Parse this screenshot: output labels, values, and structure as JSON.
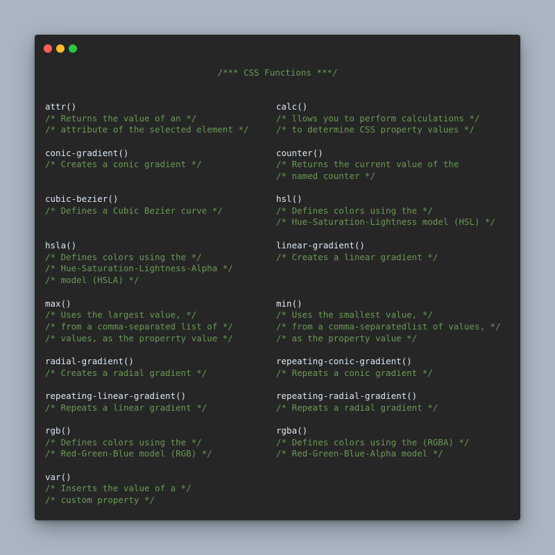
{
  "window": {
    "controls": [
      "close",
      "minimize",
      "maximize"
    ],
    "title_comment": "/*** CSS Functions ***/"
  },
  "left_column": [
    {
      "name": "attr",
      "parens": "()",
      "comments": [
        "/* Returns the value of an */",
        "/* attribute of the selected element */"
      ]
    },
    {
      "name": "conic-gradient",
      "parens": "()",
      "comments": [
        "/* Creates a conic gradient */"
      ]
    },
    {
      "name": "cubic-bezier",
      "parens": "()",
      "comments": [
        "/* Defines a Cubic Bezier curve */"
      ]
    },
    {
      "name": "hsla",
      "parens": "()",
      "comments": [
        "/* Defines colors using the */",
        "/* Hue-Saturation-Lightness-Alpha */",
        "/* model (HSLA) */"
      ]
    },
    {
      "name": "max",
      "parens": "()",
      "comments": [
        "/* Uses the largest value, */",
        "/* from a comma-separated list of */",
        "/* values, as the properrty value */"
      ]
    },
    {
      "name": "radial-gradient",
      "parens": "()",
      "comments": [
        "/* Creates a radial gradient */"
      ]
    },
    {
      "name": "repeating-linear-gradient",
      "parens": "()",
      "comments": [
        "/* Repeats a linear gradient */"
      ]
    },
    {
      "name": "rgb",
      "parens": "()",
      "comments": [
        "/* Defines colors using the */",
        "/* Red-Green-Blue model (RGB) */"
      ]
    },
    {
      "name": "var",
      "parens": "()",
      "comments": [
        "/* Inserts the value of a */",
        "/* custom property */"
      ]
    }
  ],
  "right_column": [
    {
      "name": "calc",
      "parens": "()",
      "comments": [
        "/* llows you to perform calculations */",
        "/* to determine CSS property values */"
      ]
    },
    {
      "name": "counter",
      "parens": "()",
      "comments": [
        "/* Returns the current value of the",
        "/* named counter */"
      ]
    },
    {
      "name": "hsl",
      "parens": "()",
      "comments": [
        "/* Defines colors using the */",
        "/* Hue-Saturation-Lightness model (HSL) */"
      ]
    },
    {
      "name": "linear-gradient",
      "parens": "()",
      "comments": [
        "/* Creates a linear gradient */"
      ]
    },
    {
      "name": "min",
      "parens": "()",
      "comments": [
        "/* Uses the smallest value, */",
        "/* from a comma-separatedlist of values, */",
        "/* as the property value */"
      ]
    },
    {
      "name": "repeating-conic-gradient",
      "parens": "()",
      "comments": [
        "/* Repeats a conic gradient */"
      ]
    },
    {
      "name": "repeating-radial-gradient",
      "parens": "()",
      "comments": [
        "/* Repeats a radial gradient */"
      ]
    },
    {
      "name": "rgba",
      "parens": "()",
      "comments": [
        "/* Defines colors using the (RGBA) */",
        "/* Red-Green-Blue-Alpha model */"
      ]
    }
  ],
  "colors": {
    "background": "#a9b6c2",
    "window": "#262626",
    "function_name": "#dce7f3",
    "comment": "#6a9955",
    "close": "#ff5f57",
    "minimize": "#febc2e",
    "maximize": "#28c840"
  }
}
